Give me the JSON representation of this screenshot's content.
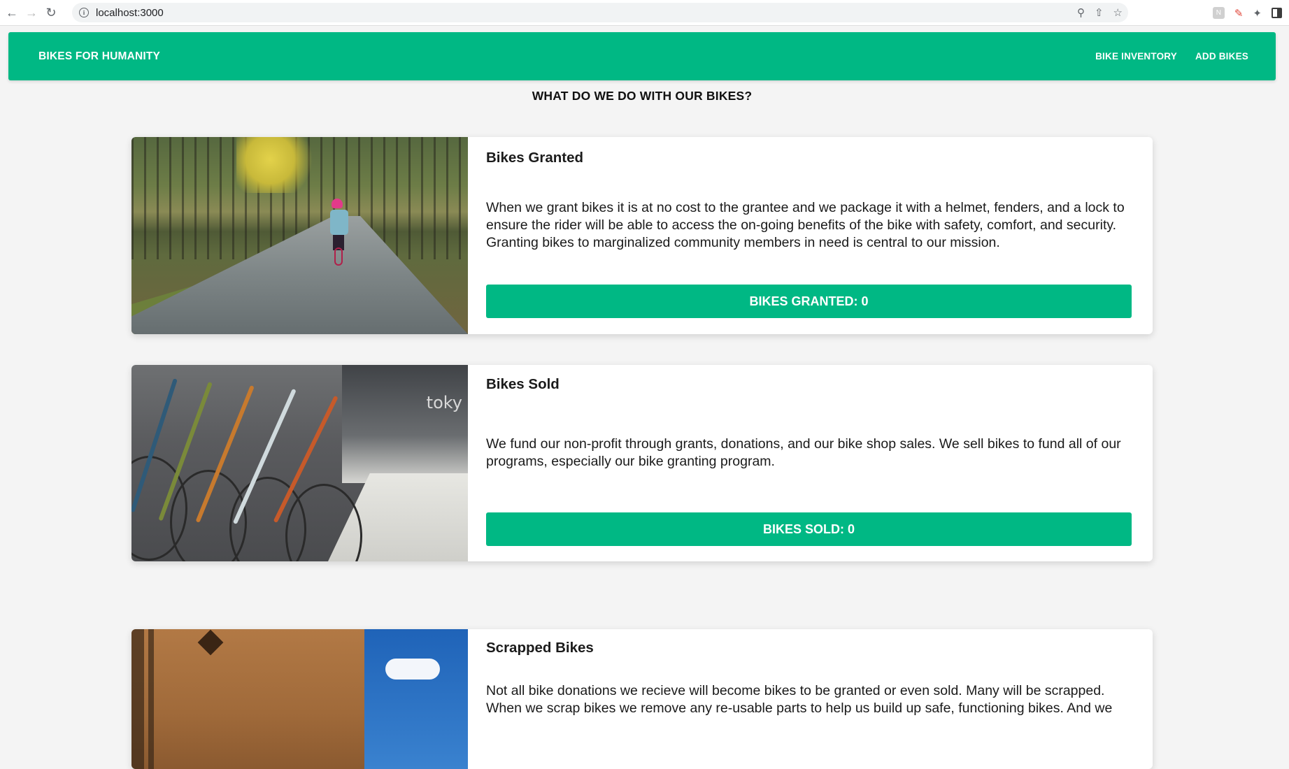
{
  "browser": {
    "url": "localhost:3000"
  },
  "header": {
    "brand": "BIKES FOR HUMANITY",
    "nav": [
      "BIKE INVENTORY",
      "ADD BIKES"
    ]
  },
  "page": {
    "heading": "WHAT DO WE DO WITH OUR BIKES?"
  },
  "cards": [
    {
      "title": "Bikes Granted",
      "text": "When we grant bikes it is at no cost to the grantee and we package it with a helmet, fenders, and a lock to ensure the rider will be able to access the on-going benefits of the bike with safety, comfort, and security. Granting bikes to marginalized community members in need is central to our mission.",
      "button": "BIKES GRANTED: 0"
    },
    {
      "title": "Bikes Sold",
      "text": "We fund our non-profit through grants, donations, and our bike shop sales. We sell bikes to fund all of our programs, especially our bike granting program.",
      "button": "BIKES SOLD: 0"
    },
    {
      "title": "Scrapped Bikes",
      "text": "Not all bike donations we recieve will become bikes to be granted or even sold. Many will be scrapped. When we scrap bikes we remove any re-usable parts to help us build up safe, functioning bikes. And we"
    }
  ],
  "colors": {
    "accent": "#00b884",
    "background": "#f4f4f4"
  }
}
